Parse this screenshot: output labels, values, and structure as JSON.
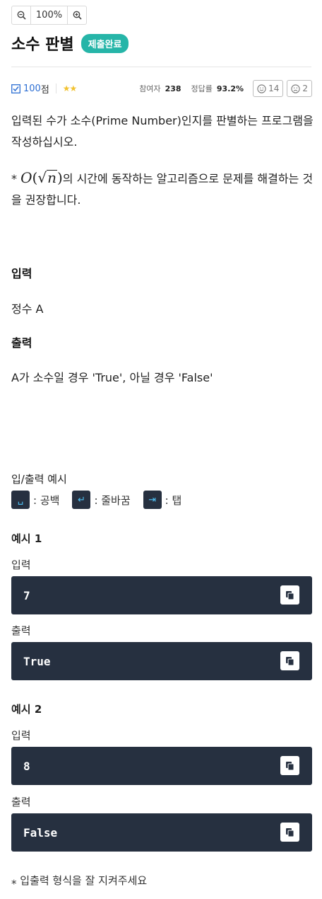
{
  "toolbar": {
    "zoom_out_icon": "zoom-out-icon",
    "zoom_level": "100%",
    "zoom_in_icon": "zoom-in-icon"
  },
  "problem": {
    "title": "소수 판별",
    "status_badge": "제출완료",
    "score_value": "100",
    "score_unit": "점",
    "difficulty_stars": "★★",
    "participants_label": "참여자",
    "participants_value": "238",
    "accuracy_label": "정답률",
    "accuracy_value": "93.2%",
    "likes": "14",
    "dislikes": "2",
    "description_line1": "입력된 수가 소수(Prime Number)인지를 판별하는 프로그램을 작성하십시오.",
    "description_note_prefix": "* ",
    "description_math_o": "O",
    "description_math_n": "n",
    "description_note_suffix": "의 시간에 동작하는 알고리즘으로 문제를 해결하는 것을 권장합니다."
  },
  "input_section": {
    "title": "입력",
    "text": "정수 A"
  },
  "output_section": {
    "title": "출력",
    "text": "A가 소수일 경우 'True', 아닐 경우 'False'"
  },
  "io_examples": {
    "heading": "입/출력 예시",
    "legend": [
      {
        "symbol": "␣",
        "label": ": 공백"
      },
      {
        "symbol": "↵",
        "label": ": 줄바꿈"
      },
      {
        "symbol": "⇥",
        "label": ": 탭"
      }
    ],
    "examples": [
      {
        "title": "예시 1",
        "input_label": "입력",
        "input": "7",
        "output_label": "출력",
        "output": "True"
      },
      {
        "title": "예시 2",
        "input_label": "입력",
        "input": "8",
        "output_label": "출력",
        "output": "False"
      }
    ]
  },
  "footer": {
    "note": "⁎ 입출력 형식을 잘 지켜주세요"
  }
}
